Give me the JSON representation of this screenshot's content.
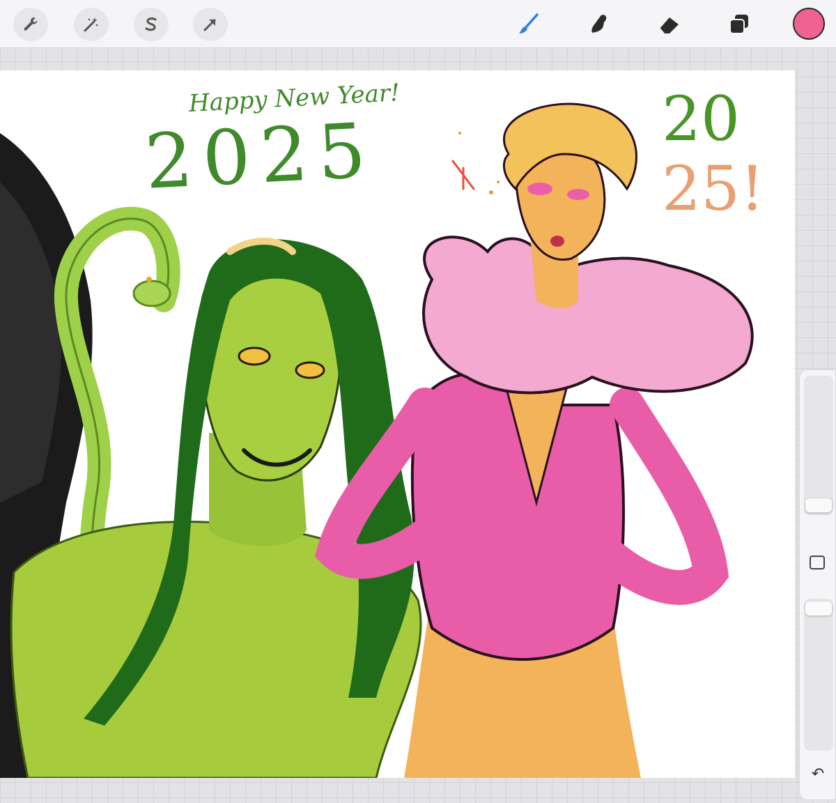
{
  "toolbar": {
    "left_tools": [
      {
        "name": "actions",
        "icon": "wrench-icon"
      },
      {
        "name": "adjustments",
        "icon": "magic-wand-icon"
      },
      {
        "name": "selection",
        "icon": "selection-s-icon"
      },
      {
        "name": "transform",
        "icon": "arrow-cursor-icon"
      }
    ],
    "right_tools": [
      {
        "name": "brush",
        "icon": "brush-icon",
        "active": true
      },
      {
        "name": "smudge",
        "icon": "smudge-finger-icon",
        "active": false
      },
      {
        "name": "eraser",
        "icon": "eraser-icon",
        "active": false
      },
      {
        "name": "layers",
        "icon": "layers-icon",
        "active": false
      }
    ],
    "current_color": "#f06292",
    "active_tool_color": "#2f7fe0"
  },
  "canvas": {
    "greeting_text": "Happy New Year!",
    "year_text": "2025",
    "year_split_top": "20",
    "year_split_bottom": "25!",
    "colors": {
      "green_ink": "#3f8a2b",
      "skin_green": "#9ccc3c",
      "hair_green": "#1f6b1a",
      "pink_suit": "#e95ca8",
      "fur_pink": "#f3a9d0",
      "blonde_hair": "#f4c25a",
      "orange_skin": "#f2b35b"
    }
  },
  "sidebar": {
    "brush_size_icon": "brush-size-slider",
    "opacity_icon": "opacity-slider",
    "modify_icon": "square-modify-icon",
    "undo_icon": "undo-arrow-icon"
  }
}
